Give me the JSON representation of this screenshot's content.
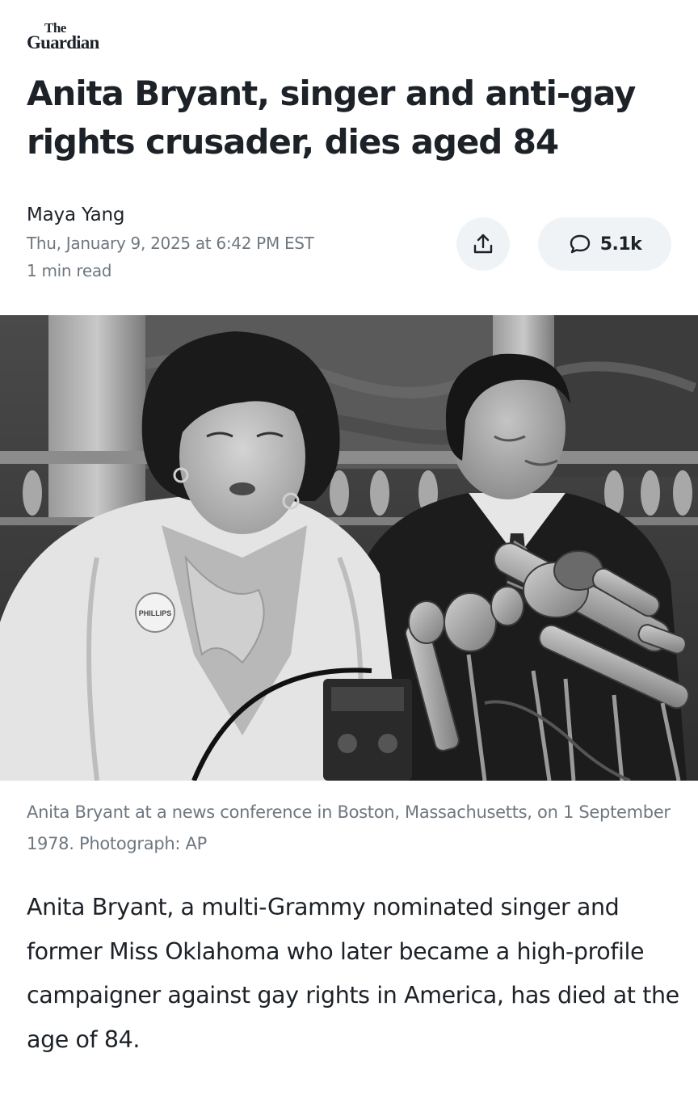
{
  "publisher": {
    "logo_line1": "The",
    "logo_line2": "Guardian"
  },
  "article": {
    "headline": "Anita Bryant, singer and anti-gay rights crusader, dies aged 84",
    "author": "Maya Yang",
    "date": "Thu, January 9, 2025 at 6:42 PM EST",
    "read_time": "1 min read",
    "image_badge_text": "PHILLIPS",
    "caption": "Anita Bryant at a news conference in Boston, Massachusetts, on 1 September 1978. Photograph: AP",
    "body": "Anita Bryant, a multi-Grammy nominated singer and former Miss Oklahoma who later became a high-profile campaigner against gay rights in America, has died at the age of 84."
  },
  "actions": {
    "share_icon": "share-icon",
    "comment_icon": "comment-bubble-icon",
    "comment_count": "5.1k"
  },
  "colors": {
    "text_primary": "#1d2228",
    "text_secondary": "#6e7780",
    "pill_background": "#f0f3f5"
  }
}
